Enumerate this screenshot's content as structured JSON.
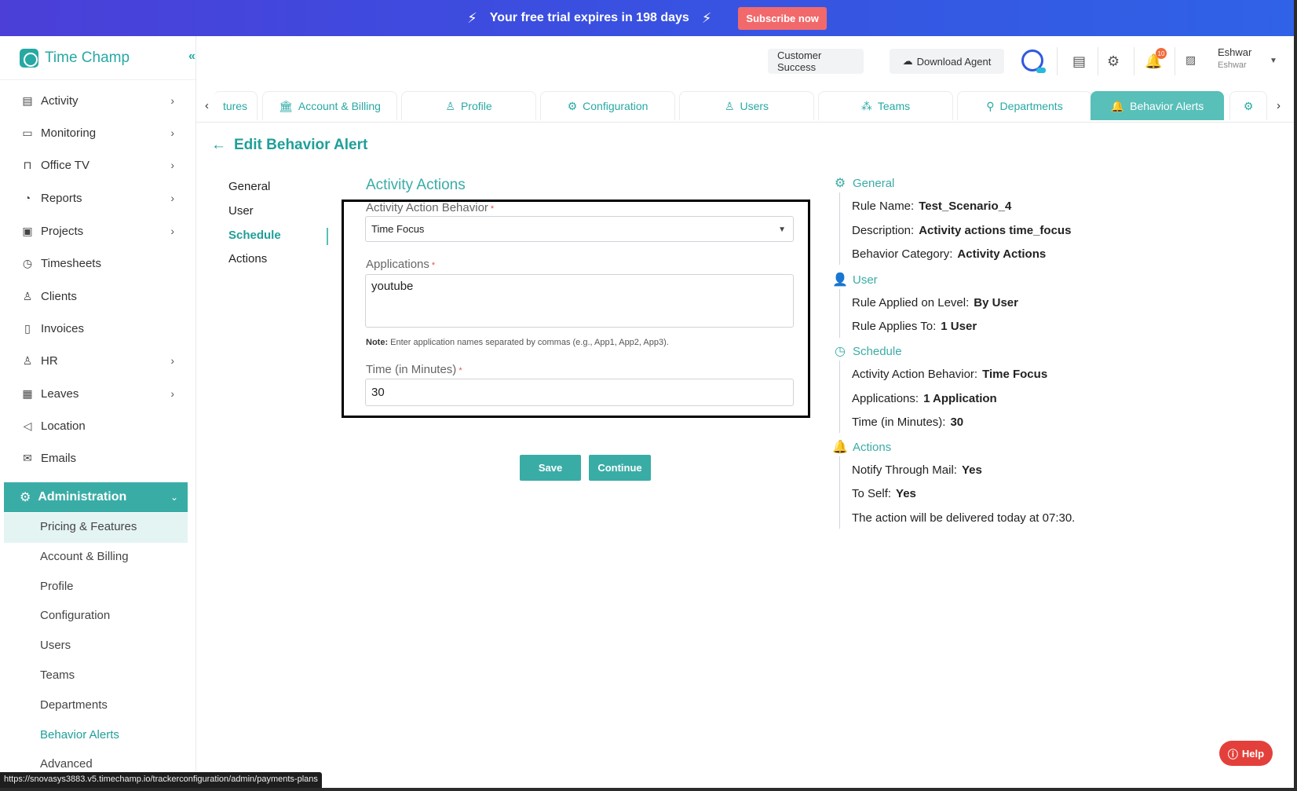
{
  "banner": {
    "trial_text": "Your free trial expires in 198 days",
    "subscribe_label": "Subscribe now"
  },
  "app": {
    "name": "Time Champ",
    "collapse_icon": "double-chevron-left-icon"
  },
  "sidebar": {
    "items": [
      {
        "label": "Activity",
        "icon": "activity-icon",
        "has_chevron": true
      },
      {
        "label": "Monitoring",
        "icon": "monitor-icon",
        "has_chevron": true
      },
      {
        "label": "Office TV",
        "icon": "tv-icon",
        "has_chevron": true
      },
      {
        "label": "Reports",
        "icon": "pie-chart-icon",
        "has_chevron": true
      },
      {
        "label": "Projects",
        "icon": "briefcase-icon",
        "has_chevron": true
      },
      {
        "label": "Timesheets",
        "icon": "clock-icon",
        "has_chevron": false
      },
      {
        "label": "Clients",
        "icon": "person-icon",
        "has_chevron": false
      },
      {
        "label": "Invoices",
        "icon": "invoice-icon",
        "has_chevron": false
      },
      {
        "label": "HR",
        "icon": "hr-icon",
        "has_chevron": true
      },
      {
        "label": "Leaves",
        "icon": "calendar-icon",
        "has_chevron": true
      },
      {
        "label": "Location",
        "icon": "location-icon",
        "has_chevron": false
      },
      {
        "label": "Emails",
        "icon": "mail-icon",
        "has_chevron": false
      }
    ],
    "admin_label": "Administration",
    "admin_sub": [
      "Pricing & Features",
      "Account & Billing",
      "Profile",
      "Configuration",
      "Users",
      "Teams",
      "Departments",
      "Behavior Alerts",
      "Advanced"
    ]
  },
  "header": {
    "customer_success": "Customer Success",
    "download_agent": "Download Agent",
    "notification_count": "10",
    "user_name": "Eshwar",
    "user_sub": "Eshwar"
  },
  "tabs": [
    "tures",
    "Account & Billing",
    "Profile",
    "Configuration",
    "Users",
    "Teams",
    "Departments",
    "Behavior Alerts"
  ],
  "page": {
    "title": "Edit Behavior Alert",
    "steps": [
      "General",
      "User",
      "Schedule",
      "Actions"
    ],
    "active_step": "Schedule",
    "section_title": "Activity Actions",
    "behavior_label": "Activity Action Behavior",
    "behavior_value": "Time Focus",
    "applications_label": "Applications",
    "applications_value": "youtube",
    "note_label": "Note:",
    "note_text": "Enter application names separated by commas (e.g., App1, App2, App3).",
    "time_label": "Time (in Minutes)",
    "time_value": "30",
    "required_mark": "*",
    "save_label": "Save",
    "continue_label": "Continue"
  },
  "summary": {
    "general": {
      "heading": "General",
      "rule_name_label": "Rule Name:",
      "rule_name": "Test_Scenario_4",
      "description_label": "Description:",
      "description": "Activity actions time_focus",
      "category_label": "Behavior Category:",
      "category": "Activity Actions"
    },
    "user": {
      "heading": "User",
      "level_label": "Rule Applied on Level:",
      "level": "By User",
      "applies_label": "Rule Applies To:",
      "applies": "1 User"
    },
    "schedule": {
      "heading": "Schedule",
      "behavior_label": "Activity Action Behavior:",
      "behavior": "Time Focus",
      "apps_label": "Applications:",
      "apps": "1 Application",
      "time_label": "Time (in Minutes):",
      "time": "30"
    },
    "actions": {
      "heading": "Actions",
      "mail_label": "Notify Through Mail:",
      "mail": "Yes",
      "self_label": "To Self:",
      "self": "Yes",
      "delivery": "The action will be delivered today at 07:30."
    }
  },
  "help_label": "Help",
  "status_url": "https://snovasys3883.v5.timechamp.io/trackerconfiguration/admin/payments-plans",
  "colors": {
    "brand": "#27a9a3",
    "banner": "#3a4fe0",
    "subscribe": "#f2696b",
    "help": "#e3403b"
  }
}
